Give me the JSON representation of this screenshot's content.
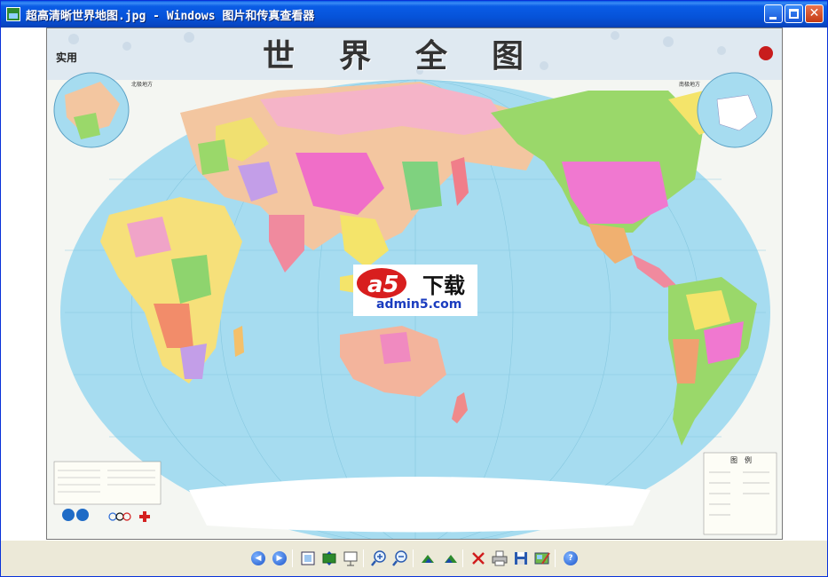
{
  "window": {
    "title": "超高清晰世界地图.jpg - Windows 图片和传真查看器",
    "min_glyph": "",
    "max_glyph": "",
    "close_glyph": "✕"
  },
  "map": {
    "title": "世界全图",
    "badge": "实用",
    "north_label": "北极地方",
    "south_label": "南极地方",
    "legend_title": "图　例"
  },
  "watermark": {
    "logo_text": "a5",
    "cn_text": "下载",
    "url": "admin5.com"
  },
  "toolbar": {
    "buttons": [
      {
        "name": "previous-image-button",
        "icon": "previous-icon"
      },
      {
        "name": "next-image-button",
        "icon": "next-icon"
      },
      {
        "name": "best-fit-button",
        "icon": "best-fit-icon"
      },
      {
        "name": "actual-size-button",
        "icon": "actual-size-icon"
      },
      {
        "name": "slideshow-button",
        "icon": "slideshow-icon"
      },
      {
        "name": "zoom-in-button",
        "icon": "zoom-in-icon"
      },
      {
        "name": "zoom-out-button",
        "icon": "zoom-out-icon"
      },
      {
        "name": "rotate-clockwise-button",
        "icon": "rotate-clockwise-icon"
      },
      {
        "name": "rotate-counterclockwise-button",
        "icon": "rotate-counterclockwise-icon"
      },
      {
        "name": "delete-button",
        "icon": "delete-icon"
      },
      {
        "name": "print-button",
        "icon": "print-icon"
      },
      {
        "name": "save-button",
        "icon": "save-icon"
      },
      {
        "name": "edit-button",
        "icon": "edit-icon"
      },
      {
        "name": "help-button",
        "icon": "help-icon"
      }
    ]
  },
  "colors": {
    "titlebar": "#0a5ce6",
    "ocean": "#a6dcf0",
    "close_button": "#c43a14",
    "watermark_red": "#d81e1e",
    "watermark_blue": "#1a3cbf"
  }
}
